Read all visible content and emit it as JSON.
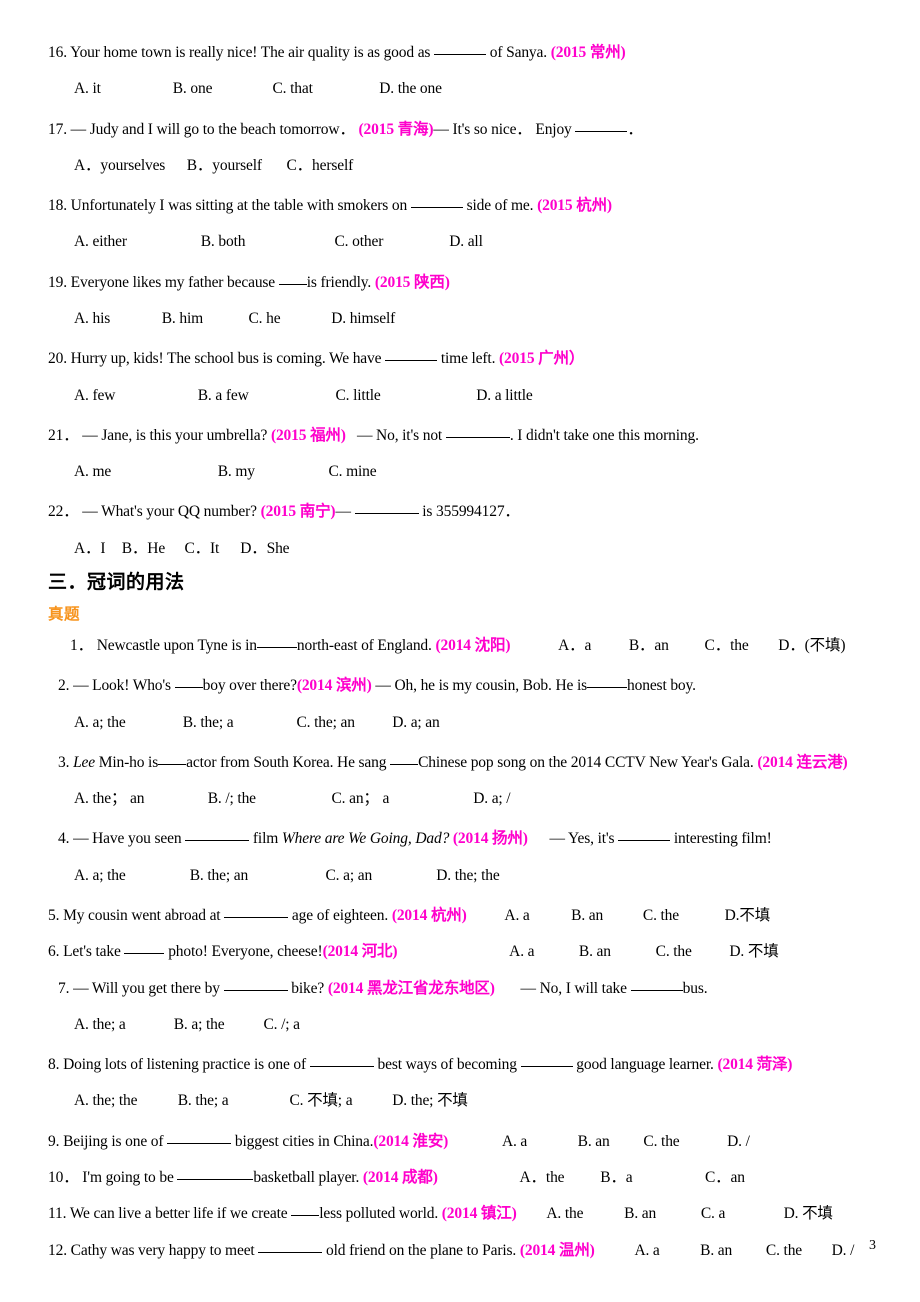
{
  "page": {
    "number": "3",
    "accent_pink": "#ff00cc",
    "accent_orange": "#f7941e"
  },
  "questions_pronouns": [
    {
      "num": "16.",
      "stem_a": "Your home town is really nice! The air quality is as good as",
      "stem_b": "of Sanya.",
      "source": "(2015 常州)",
      "options": [
        "A. it",
        "B. one",
        "C. that",
        "D. the one"
      ]
    },
    {
      "num": "17.",
      "stem_a": "— Judy and I will go to the beach tomorrow．",
      "source": "(2015 青海)",
      "stem_b": "— It's so nice．  Enjoy",
      "stem_c": "．",
      "options": [
        "A．yourselves",
        "B．yourself",
        "C．herself"
      ]
    },
    {
      "num": "18.",
      "stem_a": "Unfortunately I was sitting at the table with smokers on",
      "stem_b": "side of me.",
      "source": "(2015 杭州)",
      "options": [
        "A. either",
        "B. both",
        "C. other",
        "D. all"
      ]
    },
    {
      "num": "19.",
      "stem_a": "Everyone likes my father because",
      "stem_b": "is friendly.",
      "source": "(2015 陕西)",
      "options": [
        "A. his",
        "B. him",
        "C. he",
        "D. himself"
      ]
    },
    {
      "num": "20.",
      "stem_a": "Hurry up, kids! The school bus is coming. We have",
      "stem_b": "time left.",
      "source": "(2015 广州）",
      "options": [
        "A. few",
        "B. a few",
        "C. little",
        "D. a little"
      ]
    },
    {
      "num": "21．",
      "stem_a": "— Jane, is this your umbrella?",
      "source": "(2015 福州)",
      "stem_b": "— No, it's not",
      "stem_c": ". I didn't take one this morning.",
      "options": [
        "A. me",
        "B.    my",
        "C. mine"
      ]
    },
    {
      "num": "22．",
      "stem_a": "— What's your QQ number?",
      "source": "(2015 南宁)",
      "stem_b": "—",
      "stem_c": "is 355994127．",
      "options": [
        "A．I",
        "B．He",
        "C．It",
        "D．She"
      ]
    }
  ],
  "section": {
    "heading": "三．冠词的用法",
    "subheading": "真题"
  },
  "questions_articles": [
    {
      "num": "1．",
      "stem_a": "Newcastle upon Tyne is in",
      "stem_b": "north-east of England.",
      "source": "(2014 沈阳)",
      "inline_options": [
        "A．a",
        "B．an",
        "C．the",
        "D．(不填)"
      ]
    },
    {
      "num": "2.",
      "stem_a": "— Look! Who's",
      "stem_b": "boy over there?",
      "source": "(2014  滨州)",
      "stem_c": "— Oh, he is my cousin, Bob. He is",
      "stem_d": "honest boy.",
      "options": [
        "A. a; the",
        "B. the; a",
        "C. the; an",
        "D. a; an"
      ]
    },
    {
      "num": "3.",
      "stem_italic": "Lee",
      "stem_a": "Min-ho is",
      "stem_b": "actor from South Korea. He sang",
      "stem_c": "Chinese pop song on the 2014 CCTV New Year's Gala.",
      "source": "(2014 连云港)",
      "options": [
        "A. the；  an",
        "B. /; the",
        "C. an；  a",
        "D. a; /"
      ]
    },
    {
      "num": "4.",
      "stem_a": "— Have you seen",
      "stem_b": "film",
      "stem_italic": "Where are We Going, Dad?",
      "source": "(2014  扬州)",
      "stem_c": "— Yes, it's",
      "stem_d": "interesting film!",
      "options": [
        "A. a; the",
        "B. the; an",
        "C. a; an",
        "D. the; the"
      ]
    },
    {
      "num": "5.",
      "stem_a": "My cousin went abroad at",
      "stem_b": "age of eighteen.",
      "source": "(2014 杭州)",
      "inline_options": [
        "A. a",
        "B. an",
        "C. the",
        "D.不填"
      ]
    },
    {
      "num": "6.",
      "stem_a": "Let's take",
      "stem_b": "photo! Everyone, cheese!",
      "source": "(2014  河北)",
      "inline_options": [
        "A. a",
        "B. an",
        "C. the",
        "D. 不填"
      ]
    },
    {
      "num": "7.",
      "stem_a": "— Will you get there by",
      "stem_b": "bike?",
      "source": "(2014 黑龙江省龙东地区)",
      "stem_c": "— No, I will take",
      "stem_d": "bus.",
      "options": [
        "A. the; a",
        "B. a; the",
        "C. /; a"
      ]
    },
    {
      "num": "8.",
      "stem_a": "Doing lots of listening practice is one of",
      "stem_b": "best ways of becoming",
      "stem_c": "good language learner.",
      "source": "(2014  菏泽)",
      "options": [
        "A. the; the",
        "B. the; a",
        "C. 不填; a",
        "D. the;  不填"
      ]
    },
    {
      "num": "9.",
      "stem_a": "Beijing is one of",
      "stem_b": "biggest cities in China.",
      "source": "(2014 淮安)",
      "inline_options": [
        "A. a",
        "B. an",
        "C. the",
        "D. /"
      ]
    },
    {
      "num": "10．",
      "stem_a": "I'm going to be",
      "stem_b": "basketball player.",
      "source": "(2014  成都)",
      "inline_options": [
        "A．the",
        "B．a",
        "C．an"
      ]
    },
    {
      "num": "11.",
      "stem_a": "We can live a better life if we create",
      "stem_b": "less polluted world.",
      "source": "(2014  镇江)",
      "inline_options": [
        "A. the",
        "B. an",
        "C. a",
        "D.  不填"
      ]
    },
    {
      "num": "12.",
      "stem_a": "Cathy was very happy to meet",
      "stem_b": "old friend on the plane to Paris.",
      "source": "(2014  温州)",
      "inline_options": [
        "A. a",
        "B. an",
        "C. the",
        "D. /"
      ]
    }
  ]
}
